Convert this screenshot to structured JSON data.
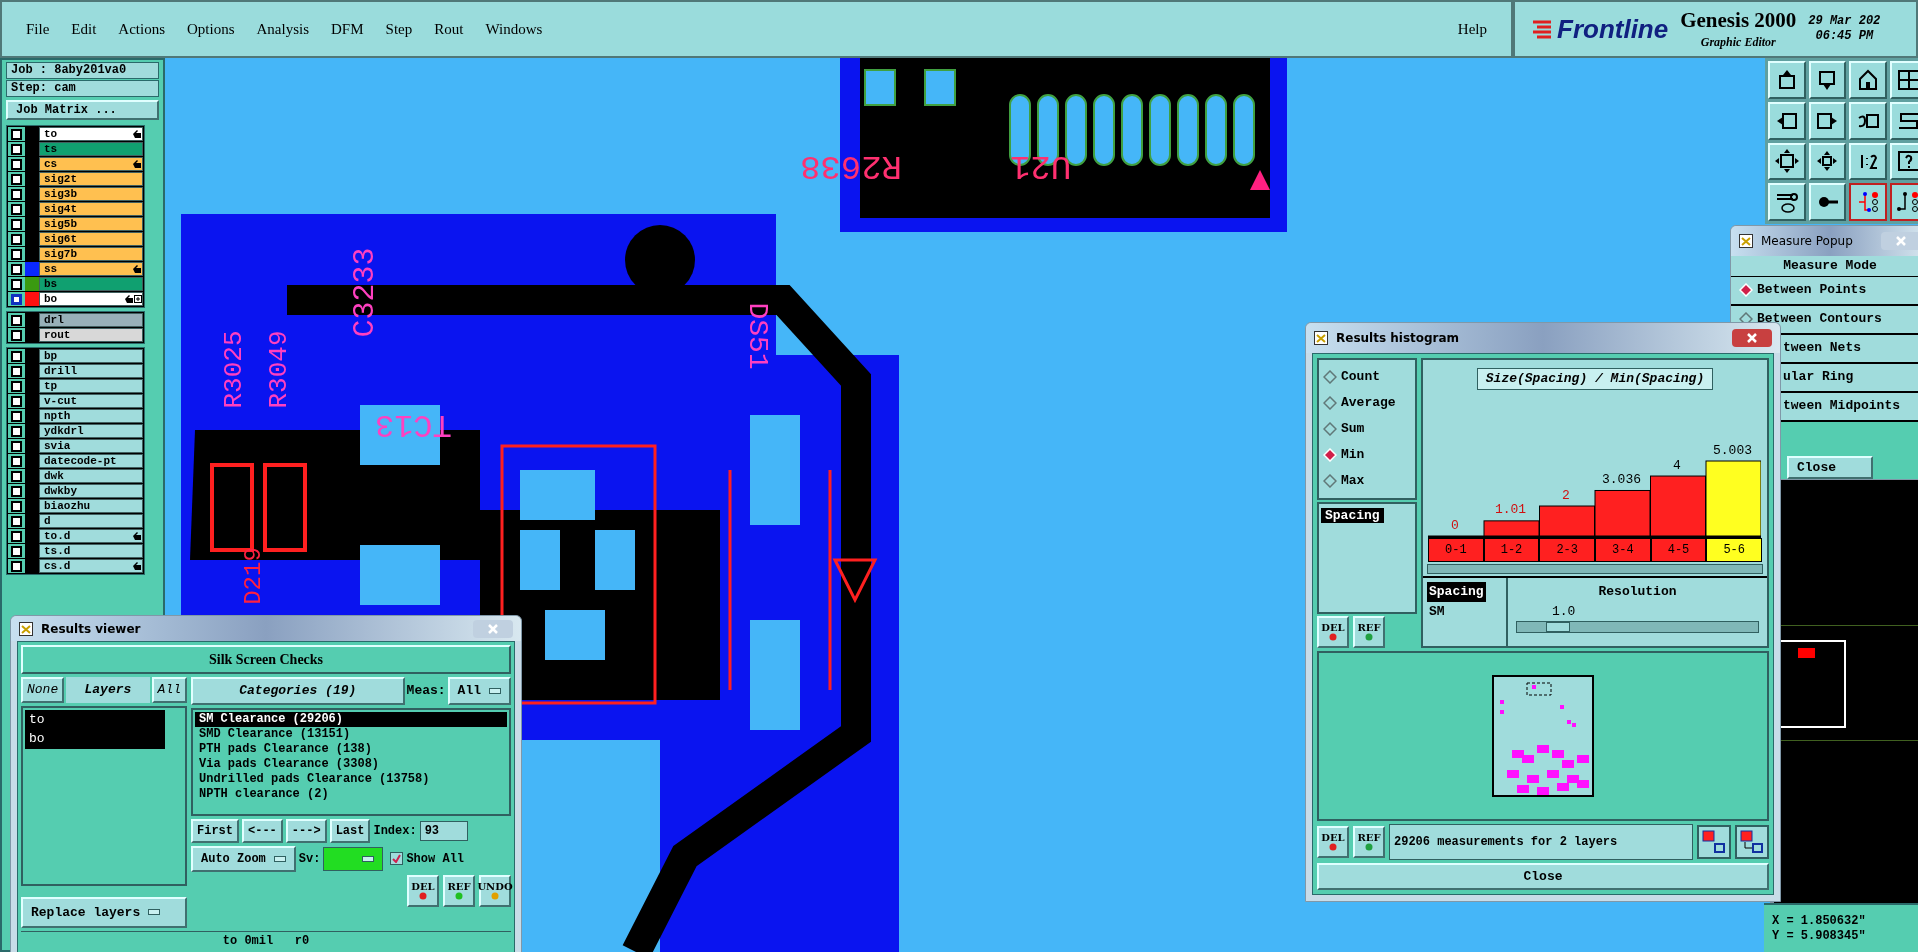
{
  "menu": {
    "items": [
      "File",
      "Edit",
      "Actions",
      "Options",
      "Analysis",
      "DFM",
      "Step",
      "Rout",
      "Windows"
    ],
    "help": "Help"
  },
  "brand": {
    "logo": "Frontline",
    "product": "Genesis 2000",
    "subtitle": "Graphic Editor",
    "date": "29 Mar 202",
    "time": "06:45 PM"
  },
  "job": {
    "job": "Job : 8aby201va0",
    "step": "Step: cam",
    "matrix_button": "Job Matrix ..."
  },
  "layer_groups": [
    [
      {
        "name": "to",
        "kind": "silk",
        "marked": true,
        "work": false,
        "attributes": false
      },
      {
        "name": "ts",
        "kind": "mask",
        "marked": false,
        "work": false,
        "attributes": false
      },
      {
        "name": "cs",
        "kind": "signal",
        "marked": true,
        "work": false,
        "attributes": false
      },
      {
        "name": "sig2t",
        "kind": "signal",
        "marked": false,
        "work": false,
        "attributes": false
      },
      {
        "name": "sig3b",
        "kind": "signal",
        "marked": false,
        "work": false,
        "attributes": false
      },
      {
        "name": "sig4t",
        "kind": "signal",
        "marked": false,
        "work": false,
        "attributes": false
      },
      {
        "name": "sig5b",
        "kind": "signal",
        "marked": false,
        "work": false,
        "attributes": false
      },
      {
        "name": "sig6t",
        "kind": "signal",
        "marked": false,
        "work": false,
        "attributes": false
      },
      {
        "name": "sig7b",
        "kind": "signal",
        "marked": false,
        "work": false,
        "attributes": false
      },
      {
        "name": "ss",
        "kind": "signal",
        "color": "#0a28ff",
        "marked": true,
        "work": false,
        "attributes": false
      },
      {
        "name": "bs",
        "kind": "mask",
        "color": "#3a9a10",
        "marked": false,
        "work": false,
        "attributes": false
      },
      {
        "name": "bo",
        "kind": "silk",
        "color": "#ff1010",
        "marked": true,
        "work": true,
        "attributes": true
      }
    ],
    [
      {
        "name": "drl",
        "kind": "drill",
        "marked": false,
        "work": false,
        "attributes": false
      },
      {
        "name": "rout",
        "kind": "rout",
        "marked": false,
        "work": false,
        "attributes": false
      }
    ],
    [
      {
        "name": "bp",
        "kind": "misc",
        "marked": false,
        "work": false,
        "attributes": false
      },
      {
        "name": "drill",
        "kind": "misc",
        "marked": false,
        "work": false,
        "attributes": false
      },
      {
        "name": "tp",
        "kind": "misc",
        "marked": false,
        "work": false,
        "attributes": false
      },
      {
        "name": "v-cut",
        "kind": "misc",
        "marked": false,
        "work": false,
        "attributes": false
      },
      {
        "name": "npth",
        "kind": "misc",
        "marked": false,
        "work": false,
        "attributes": false
      },
      {
        "name": "ydkdrl",
        "kind": "misc",
        "marked": false,
        "work": false,
        "attributes": false
      },
      {
        "name": "svia",
        "kind": "misc",
        "marked": false,
        "work": false,
        "attributes": false
      },
      {
        "name": "datecode-pt",
        "kind": "misc",
        "marked": false,
        "work": false,
        "attributes": false
      },
      {
        "name": "dwk",
        "kind": "misc",
        "marked": false,
        "work": false,
        "attributes": false
      },
      {
        "name": "dwkby",
        "kind": "misc",
        "marked": false,
        "work": false,
        "attributes": false
      },
      {
        "name": "biaozhu",
        "kind": "misc",
        "marked": false,
        "work": false,
        "attributes": false
      },
      {
        "name": "d",
        "kind": "misc",
        "marked": false,
        "work": false,
        "attributes": false
      },
      {
        "name": "to.d",
        "kind": "misc",
        "marked": true,
        "work": false,
        "attributes": false
      },
      {
        "name": "ts.d",
        "kind": "misc",
        "marked": false,
        "work": false,
        "attributes": false
      },
      {
        "name": "cs.d",
        "kind": "misc",
        "marked": true,
        "work": false,
        "attributes": false
      }
    ]
  ],
  "canvas": {
    "labels": [
      {
        "text": "R2638",
        "kind": "flip"
      },
      {
        "text": "U21",
        "kind": "flip"
      },
      {
        "text": "C3233",
        "kind": "up"
      },
      {
        "text": "TC13",
        "kind": "flip"
      },
      {
        "text": "DS51",
        "kind": "down"
      },
      {
        "text": "R3025",
        "kind": "up"
      },
      {
        "text": "R3049",
        "kind": "up"
      },
      {
        "text": "D219",
        "kind": "up"
      }
    ]
  },
  "measure_popup": {
    "title": "Measure Popup",
    "heading": "Measure Mode",
    "modes": [
      {
        "label": "Between Points",
        "selected": true
      },
      {
        "label": "Between Contours",
        "selected": false
      },
      {
        "label": "tween Nets",
        "selected": false
      },
      {
        "label": "ular Ring",
        "selected": false
      },
      {
        "label": "tween Midpoints",
        "selected": false
      }
    ],
    "close": "Close"
  },
  "coordinates": {
    "x": "X = 1.850632\"",
    "y": "Y = 5.908345\""
  },
  "results_viewer": {
    "title": "Results viewer",
    "heading": "Silk Screen Checks",
    "none_button": "None",
    "layers_label": "Layers",
    "all_button": "All",
    "layers": [
      {
        "name": "to",
        "selected": true
      },
      {
        "name": "bo",
        "selected": true
      }
    ],
    "categories_button": "Categories (19)",
    "meas_label": "Meas:",
    "meas_value": "All",
    "categories": [
      {
        "label": "SM Clearance (29206)",
        "selected": true
      },
      {
        "label": "SMD Clearance (13151)",
        "selected": false
      },
      {
        "label": "PTH pads Clearance (138)",
        "selected": false
      },
      {
        "label": "Via pads Clearance (3308)",
        "selected": false
      },
      {
        "label": "Undrilled pads Clearance (13758)",
        "selected": false
      },
      {
        "label": "NPTH clearance (2)",
        "selected": false
      }
    ],
    "nav": [
      "First",
      "<---",
      "--->",
      "Last"
    ],
    "index_label": "Index:",
    "index_value": "93",
    "zoom_mode": "Auto Zoom",
    "sv_label": "Sv:",
    "show_all": {
      "label": "Show All",
      "checked": true
    },
    "actions": [
      "DEL",
      "REF",
      "UNDO"
    ],
    "replace_mode": "Replace layers",
    "status": "to 0mil   r0"
  },
  "histogram": {
    "title": "Results histogram",
    "functions": [
      {
        "label": "Count",
        "selected": false
      },
      {
        "label": "Average",
        "selected": false
      },
      {
        "label": "Sum",
        "selected": false
      },
      {
        "label": "Min",
        "selected": true
      },
      {
        "label": "Max",
        "selected": false
      }
    ],
    "attributes": [
      {
        "label": "Spacing",
        "selected": true
      }
    ],
    "chart_data": {
      "type": "bar",
      "title": "Size(Spacing) / Min(Spacing)",
      "categories": [
        "0-1",
        "1-2",
        "2-3",
        "3-4",
        "4-5",
        "5-6"
      ],
      "values": [
        0,
        1.01,
        2,
        3.036,
        4,
        5.003
      ],
      "data_labels": true
    },
    "bins": [
      {
        "selected": false
      },
      {
        "selected": false
      },
      {
        "selected": false
      },
      {
        "selected": false
      },
      {
        "selected": false
      },
      {
        "selected": true
      }
    ],
    "measures": [
      {
        "label": "Spacing",
        "selected": true
      },
      {
        "label": "SM",
        "selected": false
      }
    ],
    "resolution_label": "Resolution",
    "resolution_value": "1.0",
    "resolution": {
      "level": 0.12
    },
    "left_actions": [
      "DEL",
      "REF"
    ],
    "bottom_actions": [
      "DEL",
      "REF"
    ],
    "status": "29206 measurements for 2 layers",
    "close": "Close"
  }
}
